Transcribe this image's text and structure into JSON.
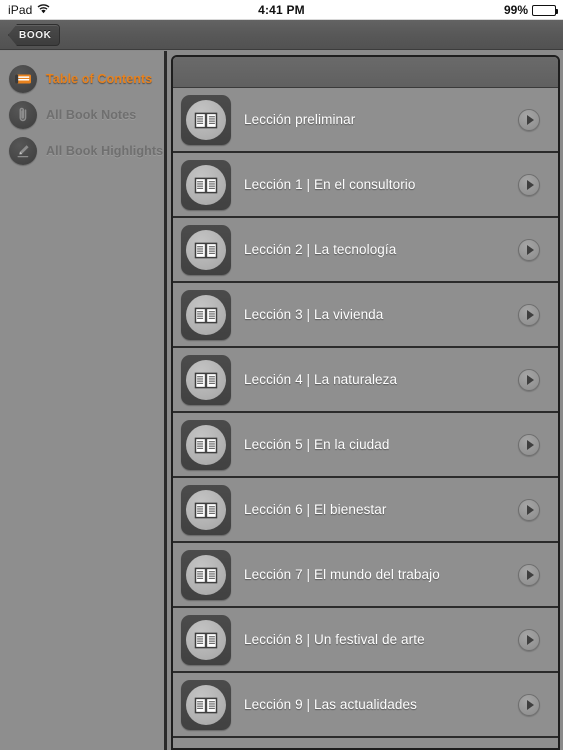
{
  "statusbar": {
    "device": "iPad",
    "wifi_icon": "wifi-icon",
    "time": "4:41 PM",
    "battery_percent": "99%",
    "battery_icon": "battery-icon"
  },
  "navbar": {
    "back_label": "BOOK",
    "back_icon": "back-chevron-icon"
  },
  "sidebar": {
    "items": [
      {
        "label": "Table of Contents",
        "icon": "book-icon",
        "active": true
      },
      {
        "label": "All Book Notes",
        "icon": "paperclip-icon",
        "active": false
      },
      {
        "label": "All Book Highlights",
        "icon": "highlighter-icon",
        "active": false
      }
    ]
  },
  "content": {
    "rows": [
      {
        "label": "Lección preliminar",
        "icon": "open-book-icon",
        "go_icon": "play-circle-icon"
      },
      {
        "label": "Lección 1 | En el consultorio",
        "icon": "open-book-icon",
        "go_icon": "play-circle-icon"
      },
      {
        "label": "Lección 2 | La tecnología",
        "icon": "open-book-icon",
        "go_icon": "play-circle-icon"
      },
      {
        "label": "Lección 3 | La vivienda",
        "icon": "open-book-icon",
        "go_icon": "play-circle-icon"
      },
      {
        "label": "Lección 4 | La naturaleza",
        "icon": "open-book-icon",
        "go_icon": "play-circle-icon"
      },
      {
        "label": "Lección 5 | En la ciudad",
        "icon": "open-book-icon",
        "go_icon": "play-circle-icon"
      },
      {
        "label": "Lección 6 | El bienestar",
        "icon": "open-book-icon",
        "go_icon": "play-circle-icon"
      },
      {
        "label": "Lección 7 | El mundo del trabajo",
        "icon": "open-book-icon",
        "go_icon": "play-circle-icon"
      },
      {
        "label": "Lección 8 | Un festival de arte",
        "icon": "open-book-icon",
        "go_icon": "play-circle-icon"
      },
      {
        "label": "Lección 9 | Las actualidades",
        "icon": "open-book-icon",
        "go_icon": "play-circle-icon"
      }
    ]
  },
  "colors": {
    "accent_orange": "#e8821e",
    "row_background": "#8f8f8f",
    "sidebar_background": "#8e8e8e",
    "navbar_background": "#5a5a5a",
    "inactive_label": "#6f6f6f"
  }
}
